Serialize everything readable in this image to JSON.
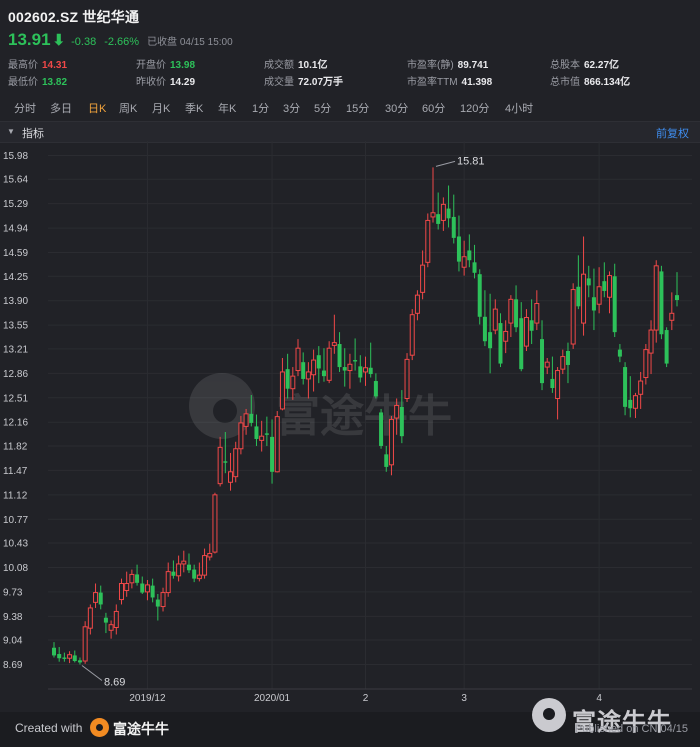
{
  "header": {
    "title": "002602.SZ 世纪华通",
    "price": "13.91",
    "arrow": "⬇",
    "change": "-0.38",
    "change_pct": "-2.66%",
    "market_status": "已收盘 04/15 15:00"
  },
  "stats": {
    "high_label": "最高价",
    "high_value": "14.31",
    "low_label": "最低价",
    "low_value": "13.82",
    "open_label": "开盘价",
    "open_value": "13.98",
    "prev_close_label": "昨收价",
    "prev_close_value": "14.29",
    "turnover_label": "成交额",
    "turnover_value": "10.1亿",
    "volume_label": "成交量",
    "volume_value": "72.07万手",
    "pe_static_label": "市盈率(静)",
    "pe_static_value": "89.741",
    "pe_ttm_label": "市盈率TTM",
    "pe_ttm_value": "41.398",
    "total_shares_label": "总股本",
    "total_shares_value": "62.27亿",
    "market_cap_label": "总市值",
    "market_cap_value": "866.134亿"
  },
  "periods": [
    "分时",
    "多日",
    "日K",
    "周K",
    "月K",
    "季K",
    "年K",
    "1分",
    "3分",
    "5分",
    "15分",
    "30分",
    "60分",
    "120分",
    "4小时"
  ],
  "active_period": "日K",
  "indicator_bar": {
    "label": "指标",
    "adjust": "前复权"
  },
  "watermark": "富途牛牛",
  "footer": {
    "created_with": "Created with",
    "brand": "富途牛牛",
    "watermark_brand": "富途牛牛",
    "published": "Published on CN 04/15"
  },
  "colors": {
    "up": "#f04848",
    "down": "#2dc15a",
    "accent": "#f0a23c",
    "link": "#3f8ef0",
    "background": "#212227"
  },
  "chart_data": {
    "type": "candlestick",
    "y_ticks": [
      "15.98",
      "15.64",
      "15.29",
      "14.94",
      "14.59",
      "14.25",
      "13.90",
      "13.55",
      "13.21",
      "12.86",
      "12.51",
      "12.16",
      "11.82",
      "11.47",
      "11.12",
      "10.77",
      "10.43",
      "10.08",
      "9.73",
      "9.38",
      "9.04",
      "8.69"
    ],
    "ylim": [
      8.59,
      16.06
    ],
    "x_labels": [
      "2019/12",
      "2020/01",
      "2",
      "3",
      "4"
    ],
    "annotations": [
      {
        "text": "15.81",
        "value": 15.81
      },
      {
        "text": "8.69",
        "value": 8.69
      }
    ],
    "grid": true,
    "series": [
      {
        "o": 8.93,
        "h": 9.01,
        "l": 8.79,
        "c": 8.82
      },
      {
        "o": 8.84,
        "h": 8.94,
        "l": 8.73,
        "c": 8.78
      },
      {
        "o": 8.79,
        "h": 8.86,
        "l": 8.73,
        "c": 8.77
      },
      {
        "o": 8.78,
        "h": 8.88,
        "l": 8.71,
        "c": 8.83
      },
      {
        "o": 8.82,
        "h": 8.89,
        "l": 8.72,
        "c": 8.74
      },
      {
        "o": 8.75,
        "h": 8.79,
        "l": 8.69,
        "c": 8.72
      },
      {
        "o": 8.74,
        "h": 9.31,
        "l": 8.7,
        "c": 9.23
      },
      {
        "o": 9.21,
        "h": 9.55,
        "l": 9.12,
        "c": 9.5
      },
      {
        "o": 9.58,
        "h": 9.85,
        "l": 9.5,
        "c": 9.72
      },
      {
        "o": 9.72,
        "h": 9.82,
        "l": 9.48,
        "c": 9.55
      },
      {
        "o": 9.36,
        "h": 9.43,
        "l": 9.14,
        "c": 9.29
      },
      {
        "o": 9.18,
        "h": 9.32,
        "l": 9.06,
        "c": 9.26
      },
      {
        "o": 9.22,
        "h": 9.55,
        "l": 9.12,
        "c": 9.45
      },
      {
        "o": 9.62,
        "h": 9.92,
        "l": 9.55,
        "c": 9.85
      },
      {
        "o": 9.75,
        "h": 10.02,
        "l": 9.66,
        "c": 9.85
      },
      {
        "o": 9.86,
        "h": 10.05,
        "l": 9.78,
        "c": 9.98
      },
      {
        "o": 9.98,
        "h": 10.12,
        "l": 9.82,
        "c": 9.86
      },
      {
        "o": 9.85,
        "h": 9.95,
        "l": 9.7,
        "c": 9.72
      },
      {
        "o": 9.73,
        "h": 9.9,
        "l": 9.61,
        "c": 9.83
      },
      {
        "o": 9.82,
        "h": 9.92,
        "l": 9.58,
        "c": 9.65
      },
      {
        "o": 9.62,
        "h": 9.7,
        "l": 9.32,
        "c": 9.52
      },
      {
        "o": 9.52,
        "h": 9.79,
        "l": 9.45,
        "c": 9.72
      },
      {
        "o": 9.72,
        "h": 10.15,
        "l": 9.66,
        "c": 10.02
      },
      {
        "o": 10.02,
        "h": 10.18,
        "l": 9.92,
        "c": 9.96
      },
      {
        "o": 9.96,
        "h": 10.25,
        "l": 9.88,
        "c": 10.13
      },
      {
        "o": 10.13,
        "h": 10.32,
        "l": 10.01,
        "c": 10.17
      },
      {
        "o": 10.12,
        "h": 10.28,
        "l": 10.0,
        "c": 10.04
      },
      {
        "o": 10.05,
        "h": 10.12,
        "l": 9.87,
        "c": 9.92
      },
      {
        "o": 9.92,
        "h": 10.15,
        "l": 9.88,
        "c": 9.97
      },
      {
        "o": 9.97,
        "h": 10.35,
        "l": 9.92,
        "c": 10.25
      },
      {
        "o": 10.23,
        "h": 10.42,
        "l": 10.18,
        "c": 10.28
      },
      {
        "o": 10.3,
        "h": 11.15,
        "l": 10.28,
        "c": 11.12
      },
      {
        "o": 11.28,
        "h": 11.95,
        "l": 11.24,
        "c": 11.8
      },
      {
        "o": 11.6,
        "h": 12.02,
        "l": 11.43,
        "c": 11.58
      },
      {
        "o": 11.3,
        "h": 11.72,
        "l": 11.18,
        "c": 11.45
      },
      {
        "o": 11.38,
        "h": 11.88,
        "l": 11.3,
        "c": 11.78
      },
      {
        "o": 11.78,
        "h": 12.25,
        "l": 11.7,
        "c": 12.15
      },
      {
        "o": 12.1,
        "h": 12.35,
        "l": 11.98,
        "c": 12.28
      },
      {
        "o": 12.28,
        "h": 12.55,
        "l": 12.1,
        "c": 12.15
      },
      {
        "o": 12.1,
        "h": 12.27,
        "l": 11.82,
        "c": 11.92
      },
      {
        "o": 11.9,
        "h": 12.18,
        "l": 11.74,
        "c": 11.96
      },
      {
        "o": 12.0,
        "h": 12.24,
        "l": 11.82,
        "c": 11.98
      },
      {
        "o": 11.95,
        "h": 12.2,
        "l": 11.28,
        "c": 11.45
      },
      {
        "o": 11.45,
        "h": 12.32,
        "l": 11.44,
        "c": 12.24
      },
      {
        "o": 12.35,
        "h": 13.08,
        "l": 12.33,
        "c": 12.88
      },
      {
        "o": 12.92,
        "h": 13.14,
        "l": 12.5,
        "c": 12.64
      },
      {
        "o": 12.64,
        "h": 12.95,
        "l": 12.48,
        "c": 12.82
      },
      {
        "o": 12.9,
        "h": 13.35,
        "l": 12.82,
        "c": 13.22
      },
      {
        "o": 13.02,
        "h": 13.16,
        "l": 12.7,
        "c": 12.78
      },
      {
        "o": 12.78,
        "h": 13.02,
        "l": 12.5,
        "c": 12.88
      },
      {
        "o": 12.84,
        "h": 13.2,
        "l": 12.6,
        "c": 13.05
      },
      {
        "o": 13.12,
        "h": 13.25,
        "l": 12.72,
        "c": 12.93
      },
      {
        "o": 12.9,
        "h": 13.22,
        "l": 12.74,
        "c": 12.82
      },
      {
        "o": 12.76,
        "h": 13.32,
        "l": 12.72,
        "c": 13.22
      },
      {
        "o": 13.26,
        "h": 13.7,
        "l": 13.14,
        "c": 13.3
      },
      {
        "o": 13.28,
        "h": 13.45,
        "l": 12.88,
        "c": 12.95
      },
      {
        "o": 12.95,
        "h": 13.22,
        "l": 12.67,
        "c": 12.9
      },
      {
        "o": 12.9,
        "h": 13.14,
        "l": 12.64,
        "c": 12.99
      },
      {
        "o": 13.05,
        "h": 13.36,
        "l": 12.9,
        "c": 13.03
      },
      {
        "o": 12.96,
        "h": 13.12,
        "l": 12.73,
        "c": 12.8
      },
      {
        "o": 12.88,
        "h": 13.1,
        "l": 12.68,
        "c": 12.94
      },
      {
        "o": 12.94,
        "h": 13.3,
        "l": 12.8,
        "c": 12.85
      },
      {
        "o": 12.75,
        "h": 12.86,
        "l": 12.5,
        "c": 12.53
      },
      {
        "o": 12.3,
        "h": 12.35,
        "l": 11.78,
        "c": 11.82
      },
      {
        "o": 11.7,
        "h": 11.82,
        "l": 11.45,
        "c": 11.52
      },
      {
        "o": 11.55,
        "h": 12.25,
        "l": 11.4,
        "c": 12.2
      },
      {
        "o": 12.22,
        "h": 12.5,
        "l": 11.98,
        "c": 12.4
      },
      {
        "o": 12.38,
        "h": 12.62,
        "l": 11.86,
        "c": 11.96
      },
      {
        "o": 12.5,
        "h": 13.15,
        "l": 12.45,
        "c": 13.06
      },
      {
        "o": 13.12,
        "h": 13.78,
        "l": 13.05,
        "c": 13.7
      },
      {
        "o": 13.72,
        "h": 14.05,
        "l": 13.62,
        "c": 13.98
      },
      {
        "o": 14.02,
        "h": 14.62,
        "l": 13.92,
        "c": 14.41
      },
      {
        "o": 14.45,
        "h": 15.15,
        "l": 14.38,
        "c": 15.05
      },
      {
        "o": 15.1,
        "h": 15.81,
        "l": 15.02,
        "c": 15.16
      },
      {
        "o": 15.14,
        "h": 15.45,
        "l": 14.92,
        "c": 15.0
      },
      {
        "o": 15.05,
        "h": 15.38,
        "l": 14.9,
        "c": 15.28
      },
      {
        "o": 15.22,
        "h": 15.55,
        "l": 14.95,
        "c": 15.08
      },
      {
        "o": 15.1,
        "h": 15.42,
        "l": 14.72,
        "c": 14.8
      },
      {
        "o": 14.82,
        "h": 15.12,
        "l": 14.32,
        "c": 14.46
      },
      {
        "o": 14.38,
        "h": 14.76,
        "l": 14.26,
        "c": 14.53
      },
      {
        "o": 14.62,
        "h": 14.85,
        "l": 14.38,
        "c": 14.48
      },
      {
        "o": 14.45,
        "h": 14.7,
        "l": 14.22,
        "c": 14.3
      },
      {
        "o": 14.28,
        "h": 14.35,
        "l": 13.56,
        "c": 13.67
      },
      {
        "o": 13.67,
        "h": 14.05,
        "l": 13.25,
        "c": 13.32
      },
      {
        "o": 13.45,
        "h": 14.0,
        "l": 12.86,
        "c": 13.22
      },
      {
        "o": 13.48,
        "h": 13.92,
        "l": 13.42,
        "c": 13.78
      },
      {
        "o": 13.58,
        "h": 13.72,
        "l": 12.95,
        "c": 13.0
      },
      {
        "o": 13.32,
        "h": 13.62,
        "l": 13.15,
        "c": 13.46
      },
      {
        "o": 13.58,
        "h": 13.98,
        "l": 13.38,
        "c": 13.92
      },
      {
        "o": 13.92,
        "h": 14.12,
        "l": 13.45,
        "c": 13.52
      },
      {
        "o": 13.65,
        "h": 13.88,
        "l": 12.89,
        "c": 12.92
      },
      {
        "o": 13.25,
        "h": 13.78,
        "l": 13.18,
        "c": 13.66
      },
      {
        "o": 13.62,
        "h": 13.92,
        "l": 13.28,
        "c": 13.47
      },
      {
        "o": 13.58,
        "h": 14.05,
        "l": 13.48,
        "c": 13.86
      },
      {
        "o": 13.35,
        "h": 13.62,
        "l": 12.62,
        "c": 12.72
      },
      {
        "o": 12.95,
        "h": 13.08,
        "l": 12.85,
        "c": 13.02
      },
      {
        "o": 12.78,
        "h": 13.1,
        "l": 12.58,
        "c": 12.65
      },
      {
        "o": 12.5,
        "h": 12.95,
        "l": 12.2,
        "c": 12.9
      },
      {
        "o": 12.92,
        "h": 13.2,
        "l": 12.85,
        "c": 13.1
      },
      {
        "o": 13.18,
        "h": 13.3,
        "l": 12.72,
        "c": 12.98
      },
      {
        "o": 13.28,
        "h": 14.15,
        "l": 13.21,
        "c": 14.06
      },
      {
        "o": 14.1,
        "h": 14.55,
        "l": 13.78,
        "c": 13.82
      },
      {
        "o": 13.58,
        "h": 14.82,
        "l": 13.4,
        "c": 14.28
      },
      {
        "o": 14.22,
        "h": 14.4,
        "l": 13.95,
        "c": 14.12
      },
      {
        "o": 13.95,
        "h": 14.36,
        "l": 13.48,
        "c": 13.76
      },
      {
        "o": 13.85,
        "h": 14.38,
        "l": 13.72,
        "c": 14.1
      },
      {
        "o": 14.18,
        "h": 14.45,
        "l": 13.95,
        "c": 14.04
      },
      {
        "o": 13.95,
        "h": 14.32,
        "l": 13.72,
        "c": 14.26
      },
      {
        "o": 14.25,
        "h": 14.43,
        "l": 13.38,
        "c": 13.45
      },
      {
        "o": 13.2,
        "h": 13.28,
        "l": 13.02,
        "c": 13.1
      },
      {
        "o": 12.95,
        "h": 13.02,
        "l": 12.26,
        "c": 12.38
      },
      {
        "o": 12.48,
        "h": 12.82,
        "l": 12.23,
        "c": 12.36
      },
      {
        "o": 12.36,
        "h": 12.58,
        "l": 12.22,
        "c": 12.54
      },
      {
        "o": 12.56,
        "h": 12.88,
        "l": 12.35,
        "c": 12.75
      },
      {
        "o": 12.8,
        "h": 13.28,
        "l": 12.7,
        "c": 13.2
      },
      {
        "o": 13.15,
        "h": 13.62,
        "l": 12.85,
        "c": 13.48
      },
      {
        "o": 13.48,
        "h": 14.48,
        "l": 13.3,
        "c": 14.4
      },
      {
        "o": 14.32,
        "h": 14.4,
        "l": 13.35,
        "c": 13.42
      },
      {
        "o": 13.48,
        "h": 13.52,
        "l": 12.95,
        "c": 13.0
      },
      {
        "o": 13.62,
        "h": 14.02,
        "l": 13.48,
        "c": 13.72
      },
      {
        "o": 13.98,
        "h": 14.31,
        "l": 13.82,
        "c": 13.91
      }
    ]
  }
}
